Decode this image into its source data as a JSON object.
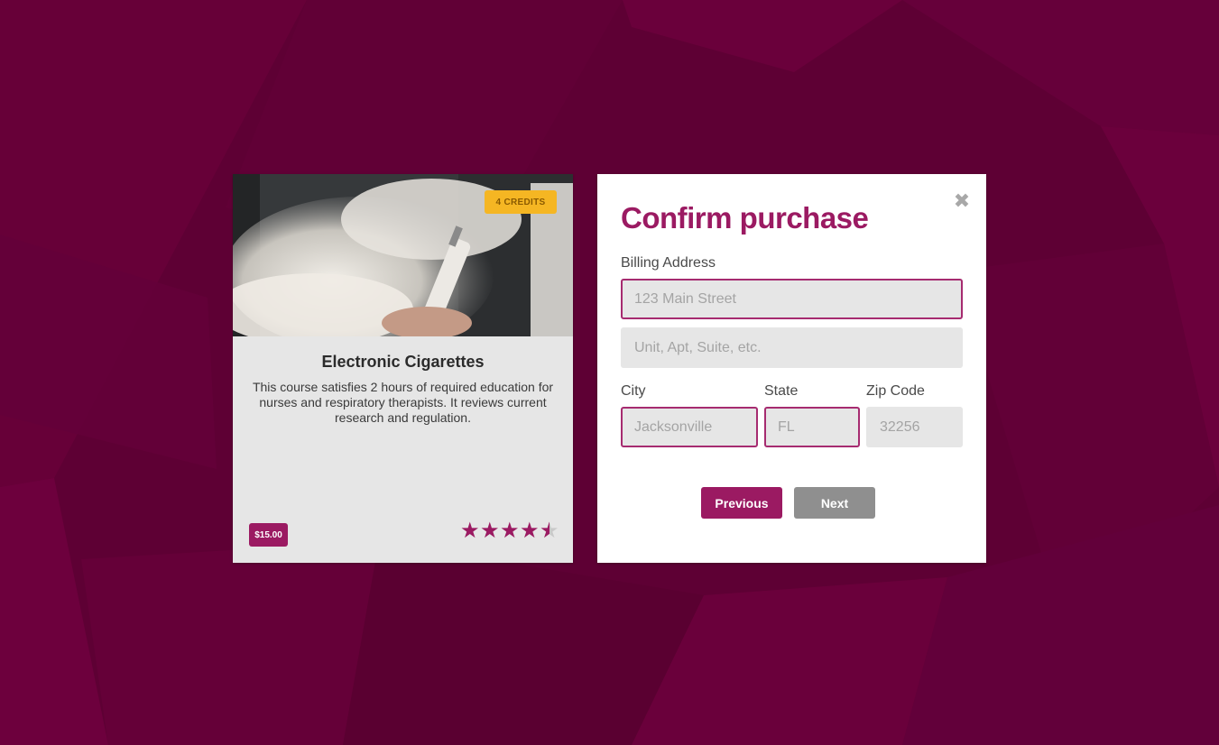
{
  "colors": {
    "brand": "#9b1a62",
    "background": "#5e0034",
    "credits_badge": "#f5b623",
    "disabled_button": "#8f8f8f"
  },
  "course_card": {
    "credits_badge": "4 CREDITS",
    "title": "Electronic Cigarettes",
    "description": "This course satisfies 2 hours of required education for nurses and respiratory therapists. It reviews current research and regulation.",
    "price": "$15.00",
    "rating": {
      "value": 4.5,
      "max": 5
    }
  },
  "modal": {
    "title": "Confirm purchase",
    "close_icon": "close-icon",
    "billing_address_label": "Billing Address",
    "address_line1": {
      "value": "",
      "placeholder": "123 Main Street"
    },
    "address_line2": {
      "value": "",
      "placeholder": "Unit, Apt, Suite, etc."
    },
    "city": {
      "label": "City",
      "value": "",
      "placeholder": "Jacksonville"
    },
    "state": {
      "label": "State",
      "value": "",
      "placeholder": "FL"
    },
    "zip": {
      "label": "Zip Code",
      "value": "",
      "placeholder": "32256"
    },
    "previous_label": "Previous",
    "next_label": "Next"
  }
}
